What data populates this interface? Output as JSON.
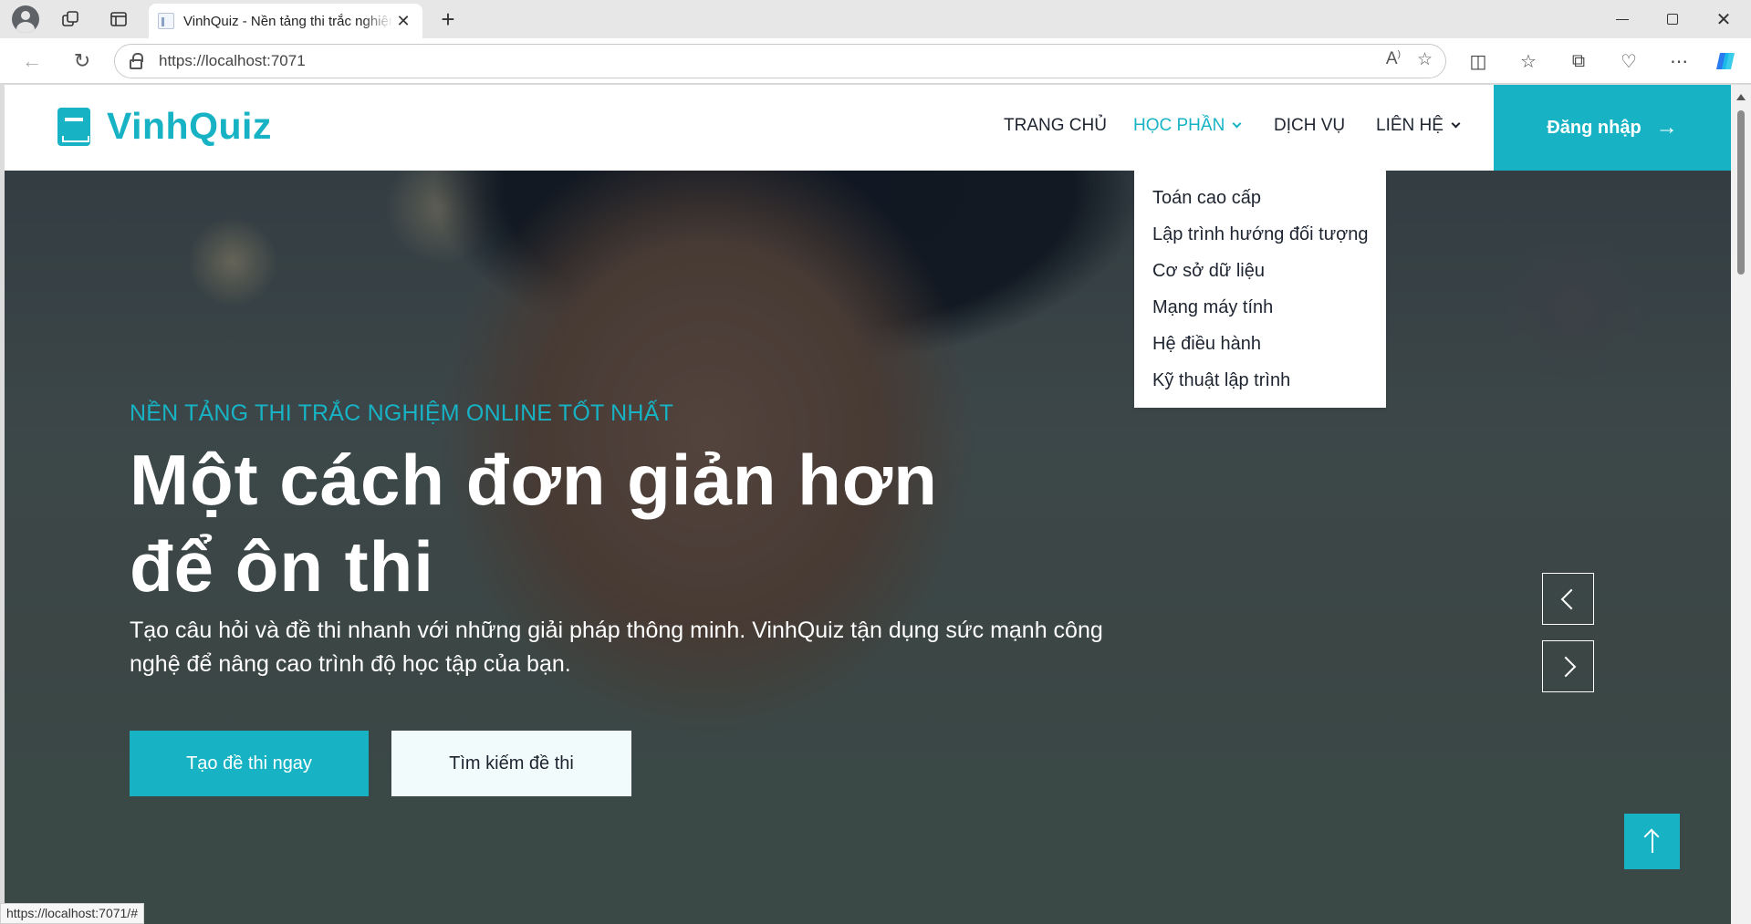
{
  "browser": {
    "tab_title": "VinhQuiz - Nền tảng thi trắc nghiệm online",
    "url": "https://localhost:7071",
    "status_url": "https://localhost:7071/#"
  },
  "site": {
    "brand": "VinhQuiz",
    "brand_color": "#17b3c4",
    "menu": {
      "home": "TRANG CHỦ",
      "courses": "HỌC PHẦN",
      "services": "DỊCH VỤ",
      "contact": "LIÊN HỆ"
    },
    "login_label": "Đăng nhập",
    "dropdown": [
      "Toán cao cấp",
      "Lập trình hướng đối tượng",
      "Cơ sở dữ liệu",
      "Mạng máy tính",
      "Hệ điều hành",
      "Kỹ thuật lập trình"
    ]
  },
  "hero": {
    "eyebrow": "NỀN TẢNG THI TRẮC NGHIỆM ONLINE TỐT NHẤT",
    "headline": "Một cách đơn giản hơn để ôn thi",
    "description": "Tạo câu hỏi và đề thi nhanh với những giải pháp thông minh. VinhQuiz tận dụng sức mạnh công nghệ để nâng cao trình độ học tập của bạn.",
    "primary_button": "Tạo đề thi ngay",
    "secondary_button": "Tìm kiếm đề thi"
  },
  "icons": [
    "profile-icon",
    "workspaces-icon",
    "tab-actions-icon",
    "favicon-icon",
    "close-icon",
    "new-tab-icon",
    "back-icon",
    "reload-icon",
    "lock-icon",
    "read-aloud-icon",
    "star-icon",
    "split-screen-icon",
    "favorites-icon",
    "collections-icon",
    "performance-icon",
    "more-icon",
    "copilot-icon",
    "book-icon",
    "chevron-down-icon",
    "arrow-right-icon",
    "chevron-left-icon",
    "chevron-right-icon",
    "arrow-up-icon"
  ]
}
